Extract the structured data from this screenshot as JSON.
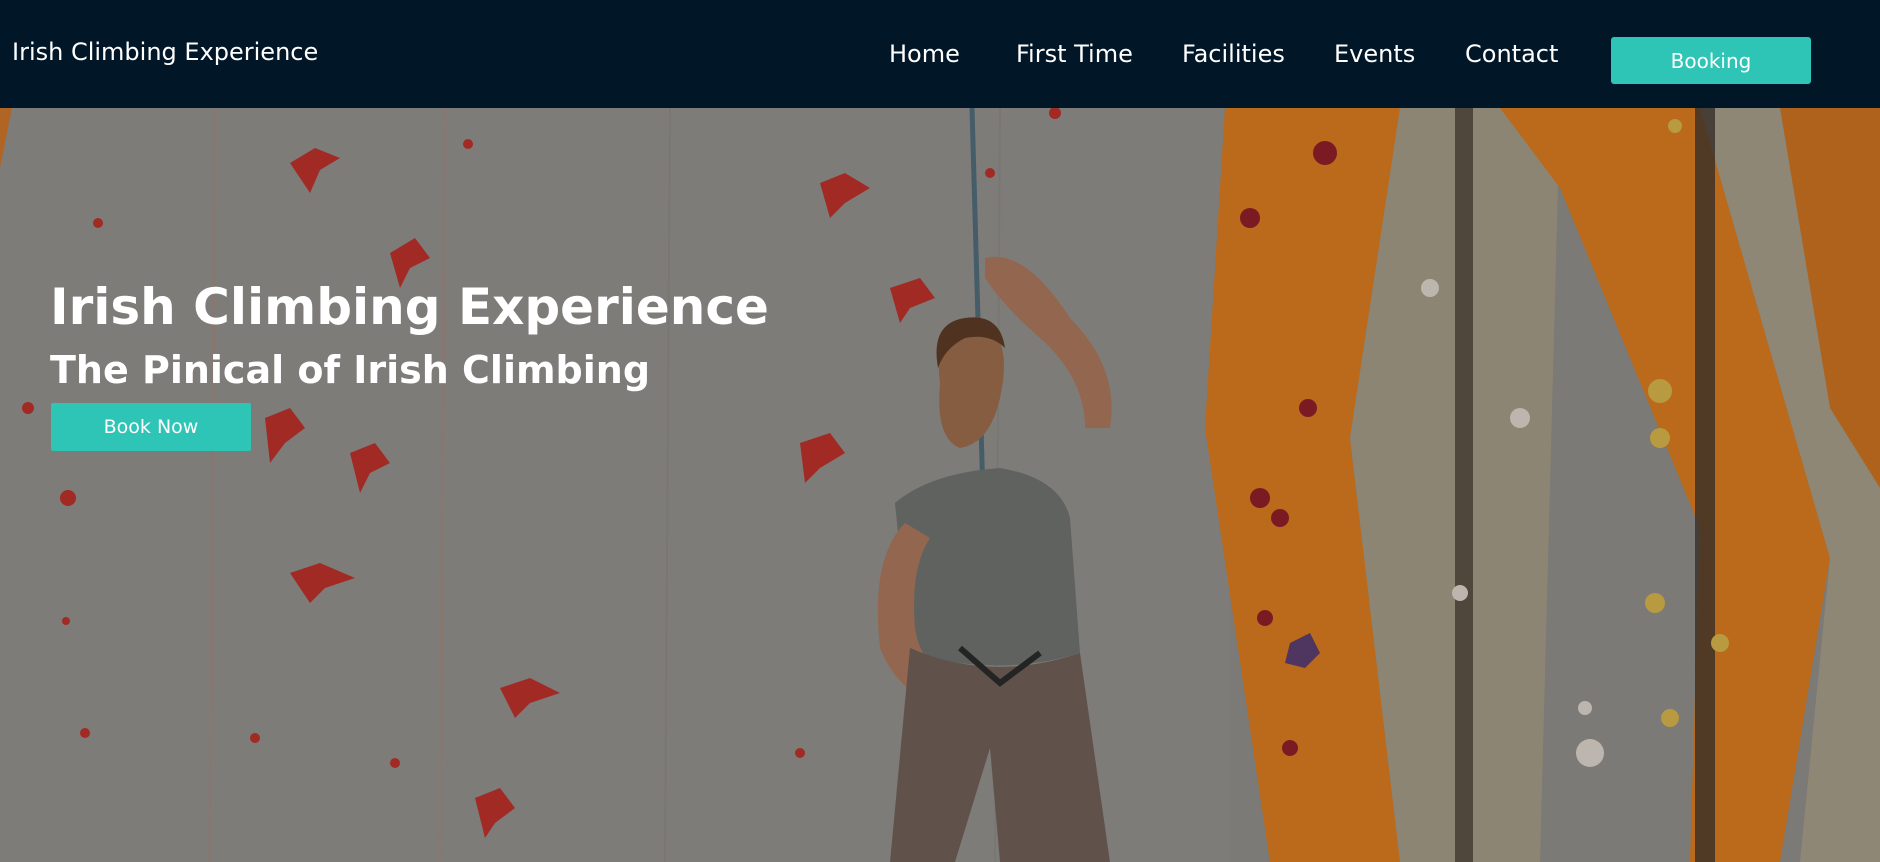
{
  "navbar": {
    "brand": "Irish Climbing Experience",
    "links": [
      "Home",
      "First Time",
      "Facilities",
      "Events",
      "Contact"
    ],
    "booking_label": "Booking"
  },
  "hero": {
    "title": "Irish Climbing Experience",
    "subtitle": "The Pinical of Irish Climbing",
    "cta_label": "Book Now",
    "image": "climber-on-indoor-wall-photo"
  },
  "colors": {
    "nav_background": "#011627",
    "accent": "#2ec4b6",
    "text": "#ffffff"
  }
}
